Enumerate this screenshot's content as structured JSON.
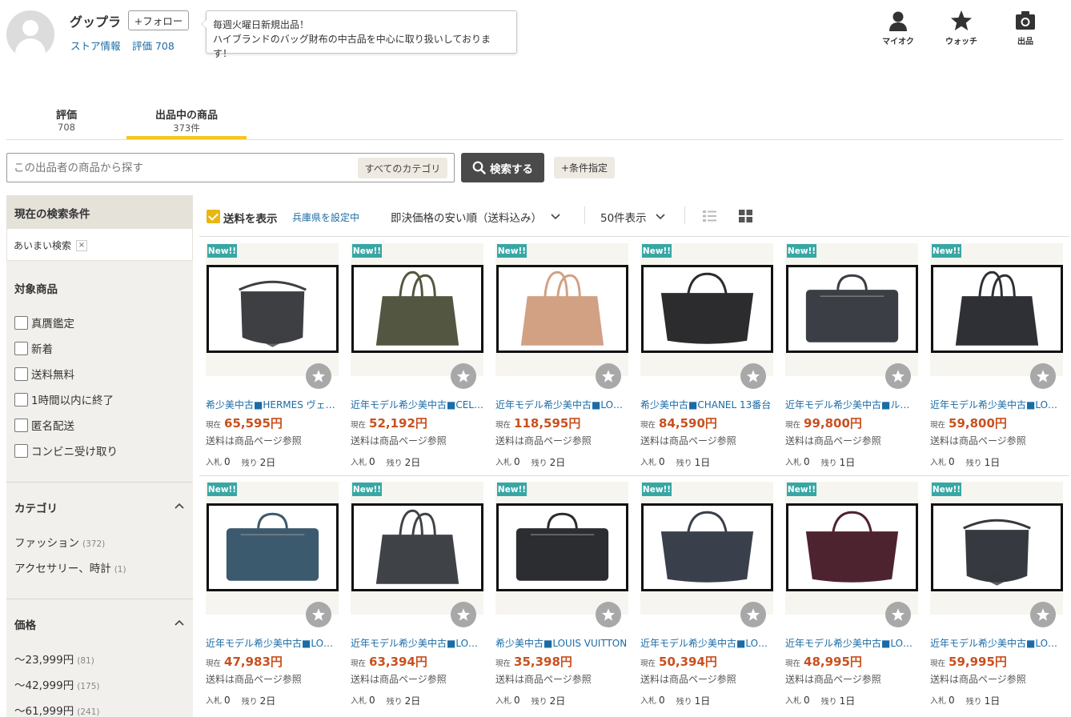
{
  "store": {
    "name": "グップラ",
    "follow_label": "+フォロー",
    "info_link": "ストア情報",
    "rating_link": "評価 708",
    "bubble_line1": "毎週火曜日新規出品！",
    "bubble_line2": "ハイブランドのバッグ財布の中古品を中心に取り扱いしております！"
  },
  "topnav": {
    "myauction": "マイオク",
    "watch": "ウォッチ",
    "sell": "出品"
  },
  "tabs": [
    {
      "label": "評価",
      "count": "708"
    },
    {
      "label": "出品中の商品",
      "count": "373件"
    }
  ],
  "search": {
    "placeholder": "この出品者の商品から探す",
    "category": "すべてのカテゴリ",
    "button": "検索する",
    "conditions": "+条件指定"
  },
  "sidebar": {
    "current_title": "現在の検索条件",
    "current_chip": "あいまい検索",
    "target_title": "対象商品",
    "target_items": [
      "真贋鑑定",
      "新着",
      "送料無料",
      "1時間以内に終了",
      "匿名配送",
      "コンビニ受け取り"
    ],
    "category_title": "カテゴリ",
    "categories": [
      {
        "label": "ファッション",
        "count": "(372)"
      },
      {
        "label": "アクセサリー、時計",
        "count": "(1)"
      }
    ],
    "price_title": "価格",
    "prices": [
      {
        "label": "〜23,999円",
        "count": "(81)"
      },
      {
        "label": "〜42,999円",
        "count": "(175)"
      },
      {
        "label": "〜61,999円",
        "count": "(241)"
      }
    ]
  },
  "toolbar": {
    "shipping": "送料を表示",
    "prefecture": "兵庫県を設定中",
    "sort": "即決価格の安い順（送料込み）",
    "count": "50件表示"
  },
  "product_common": {
    "new_badge": "New!!",
    "price_label": "現在",
    "shipping": "送料は商品ページ参照",
    "bids_label": "入札",
    "remain_label": "残り"
  },
  "products": [
    {
      "title": "希少美中古■HERMES ヴェスパ",
      "price": "65,595円",
      "bids": "0",
      "remain": "2日",
      "bag_color": "#3d3f42",
      "shape": "round"
    },
    {
      "title": "近年モデル希少美中古■CELINE",
      "price": "52,192円",
      "bids": "0",
      "remain": "2日",
      "bag_color": "#535640",
      "shape": "tote"
    },
    {
      "title": "近年モデル希少美中古■LOUIS",
      "price": "118,595円",
      "bids": "0",
      "remain": "2日",
      "bag_color": "#d2a083",
      "shape": "tote"
    },
    {
      "title": "希少美中古■CHANEL 13番台",
      "price": "84,590円",
      "bids": "0",
      "remain": "1日",
      "bag_color": "#2c2c2e",
      "shape": "wide"
    },
    {
      "title": "近年モデル希少美中古■ルイヴィトン",
      "price": "99,800円",
      "bids": "0",
      "remain": "1日",
      "bag_color": "#3b3e45",
      "shape": "brief"
    },
    {
      "title": "近年モデル希少美中古■LOUIS",
      "price": "59,800円",
      "bids": "0",
      "remain": "1日",
      "bag_color": "#2e3035",
      "shape": "tote"
    },
    {
      "title": "近年モデル希少美中古■LOUIS",
      "price": "47,983円",
      "bids": "0",
      "remain": "2日",
      "bag_color": "#3c5a6e",
      "shape": "brief"
    },
    {
      "title": "近年モデル希少美中古■LOUIS",
      "price": "63,394円",
      "bids": "0",
      "remain": "2日",
      "bag_color": "#3f4247",
      "shape": "tote"
    },
    {
      "title": "希少美中古■LOUIS VUITTON",
      "price": "35,398円",
      "bids": "0",
      "remain": "2日",
      "bag_color": "#2b2d31",
      "shape": "brief"
    },
    {
      "title": "近年モデル希少美中古■LOUIS",
      "price": "50,394円",
      "bids": "0",
      "remain": "1日",
      "bag_color": "#3a3f4c",
      "shape": "wide"
    },
    {
      "title": "近年モデル希少美中古■LOUIS",
      "price": "48,995円",
      "bids": "0",
      "remain": "1日",
      "bag_color": "#4e2330",
      "shape": "wide"
    },
    {
      "title": "近年モデル希少美中古■LOUIS",
      "price": "59,995円",
      "bids": "0",
      "remain": "1日",
      "bag_color": "#36393f",
      "shape": "round"
    }
  ]
}
